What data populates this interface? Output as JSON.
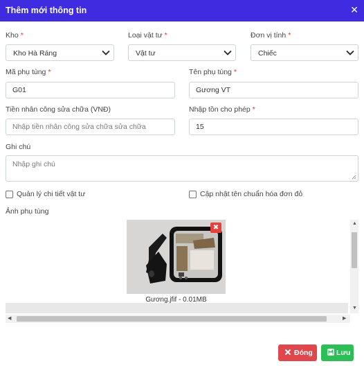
{
  "modal": {
    "title": "Thêm mới thông tin",
    "close_icon": "✕"
  },
  "form": {
    "kho": {
      "label": "Kho",
      "value": "Kho Hà Ráng"
    },
    "loai_vat_tu": {
      "label": "Loại vật tư",
      "value": "Vật tư"
    },
    "don_vi_tinh": {
      "label": "Đơn vị tính",
      "value": "Chiếc"
    },
    "ma_phu_tung": {
      "label": "Mã phụ tùng",
      "value": "G01"
    },
    "ten_phu_tung": {
      "label": "Tên phụ tùng",
      "value": "Gương VT"
    },
    "tien_nhan_cong": {
      "label": "Tiền nhân công sửa chữa (VNĐ)",
      "placeholder": "Nhập tiền nhân công sửa chữa sửa chữa"
    },
    "nhap_ton": {
      "label": "Nhập tồn cho phép",
      "value": "15"
    },
    "ghi_chu": {
      "label": "Ghi chú",
      "placeholder": "Nhập ghi chú"
    },
    "required_mark": "*",
    "checkbox_quan_ly": {
      "label": "Quản lý chi tiết vật tư",
      "checked": false
    },
    "checkbox_cap_nhat": {
      "label": "Cập nhật tên chuẩn hóa đơn đỏ",
      "checked": false
    },
    "anh_phu_tung": {
      "label": "Ảnh phụ tùng",
      "file_caption": "Gương.jfif - 0.01MB"
    }
  },
  "buttons": {
    "close_label": "Đóng",
    "save_label": "Lưu"
  },
  "colors": {
    "header": "#3f2be0",
    "danger": "#e0474c",
    "success": "#2dbe57",
    "required": "#e0342f"
  }
}
